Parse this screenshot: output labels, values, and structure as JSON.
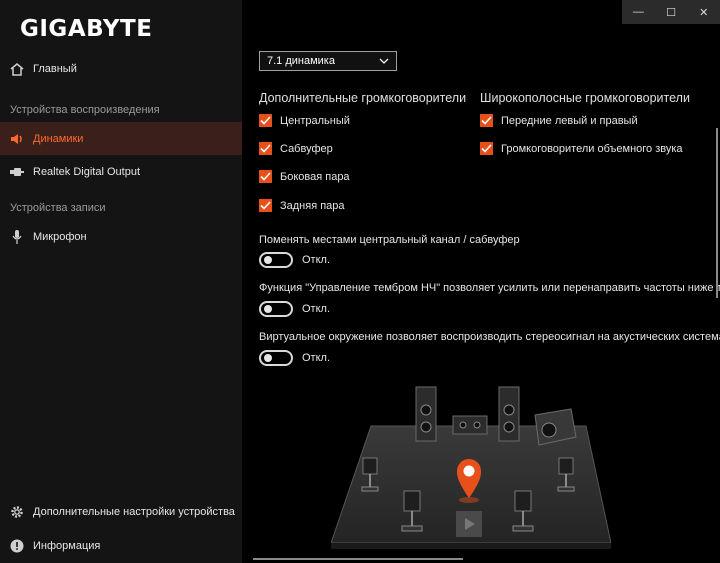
{
  "app": {
    "logo": "GIGABYTE"
  },
  "window_controls": {
    "minimize": "—",
    "maximize": "☐",
    "close": "✕"
  },
  "sidebar": {
    "home": "Главный",
    "playback_section": "Устройства воспроизведения",
    "speakers": "Динамики",
    "digital_output": "Realtek Digital Output",
    "recording_section": "Устройства записи",
    "microphone": "Микрофон",
    "advanced": "Дополнительные настройки устройства",
    "info": "Информация"
  },
  "main": {
    "config_select": "7.1 динамика",
    "extra_speakers": {
      "title": "Дополнительные громкоговорители",
      "items": [
        {
          "label": "Центральный",
          "checked": true
        },
        {
          "label": "Сабвуфер",
          "checked": true
        },
        {
          "label": "Боковая пара",
          "checked": true
        },
        {
          "label": "Задняя пара",
          "checked": true
        }
      ]
    },
    "fullrange_speakers": {
      "title": "Широкополосные громкоговорители",
      "items": [
        {
          "label": "Передние левый и правый",
          "checked": true
        },
        {
          "label": "Громкоговорители объемного звука",
          "checked": true
        }
      ]
    },
    "swap": {
      "text": "Поменять местами центральный канал / сабвуфер",
      "state": "Откл."
    },
    "bass": {
      "text": "Функция \"Управление тембром НЧ\" позволяет усилить или перенаправить частоты ниже точки",
      "state": "Откл."
    },
    "virtual": {
      "text": "Виртуальное окружение позволяет воспроизводить стереосигнал на акустических системах об",
      "state": "Откл."
    }
  },
  "colors": {
    "accent": "#e8501b",
    "active_bg": "#3a1f1a",
    "background": "#000000",
    "sidebar_bg": "#141414"
  }
}
